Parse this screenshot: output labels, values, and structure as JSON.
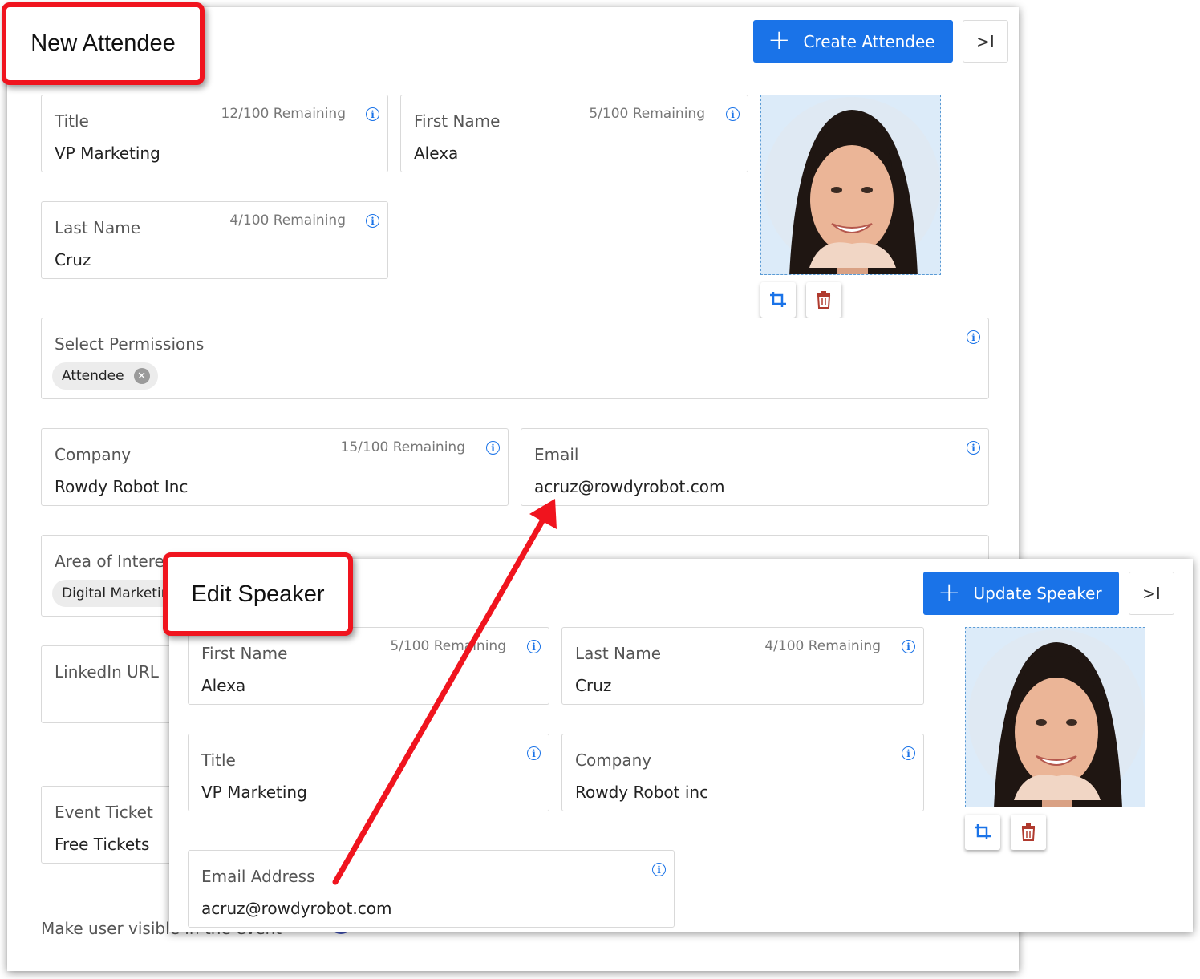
{
  "new_attendee": {
    "heading": "New Attendee",
    "create_button": "Create Attendee",
    "collapse_label": ">I",
    "fields": {
      "title": {
        "label": "Title",
        "value": "VP Marketing",
        "remaining": "12/100 Remaining"
      },
      "first_name": {
        "label": "First Name",
        "value": "Alexa",
        "remaining": "5/100 Remaining"
      },
      "last_name": {
        "label": "Last Name",
        "value": "Cruz",
        "remaining": "4/100 Remaining"
      },
      "permissions": {
        "label": "Select Permissions",
        "chip": "Attendee"
      },
      "company": {
        "label": "Company",
        "value": "Rowdy Robot Inc",
        "remaining": "15/100 Remaining"
      },
      "email": {
        "label": "Email",
        "value": "acruz@rowdyrobot.com"
      },
      "area_of_interest": {
        "label": "Area of Interest",
        "chip": "Digital Marketing"
      },
      "linkedin": {
        "label": "LinkedIn URL"
      },
      "event_ticket": {
        "label": "Event Ticket",
        "value": "Free Tickets"
      },
      "visibility": {
        "label": "Make user visible in the event",
        "toggled": true
      }
    }
  },
  "edit_speaker": {
    "heading": "Edit Speaker",
    "update_button": "Update Speaker",
    "collapse_label": ">I",
    "fields": {
      "first_name": {
        "label": "First Name",
        "value": "Alexa",
        "remaining": "5/100 Remaining"
      },
      "last_name": {
        "label": "Last Name",
        "value": "Cruz",
        "remaining": "4/100 Remaining"
      },
      "title": {
        "label": "Title",
        "value": "VP Marketing"
      },
      "company": {
        "label": "Company",
        "value": "Rowdy Robot inc"
      },
      "email": {
        "label": "Email Address",
        "value": "acruz@rowdyrobot.com"
      }
    }
  },
  "icons": [
    "plus-icon",
    "info-icon",
    "crop-icon",
    "trash-icon",
    "close-icon",
    "collapse-icon",
    "arrow-annotation"
  ],
  "colors": {
    "primary": "#1a73e8",
    "callout_red": "#f0141e",
    "trash_red": "#b03a2e",
    "toggle": "#3f51b5"
  }
}
